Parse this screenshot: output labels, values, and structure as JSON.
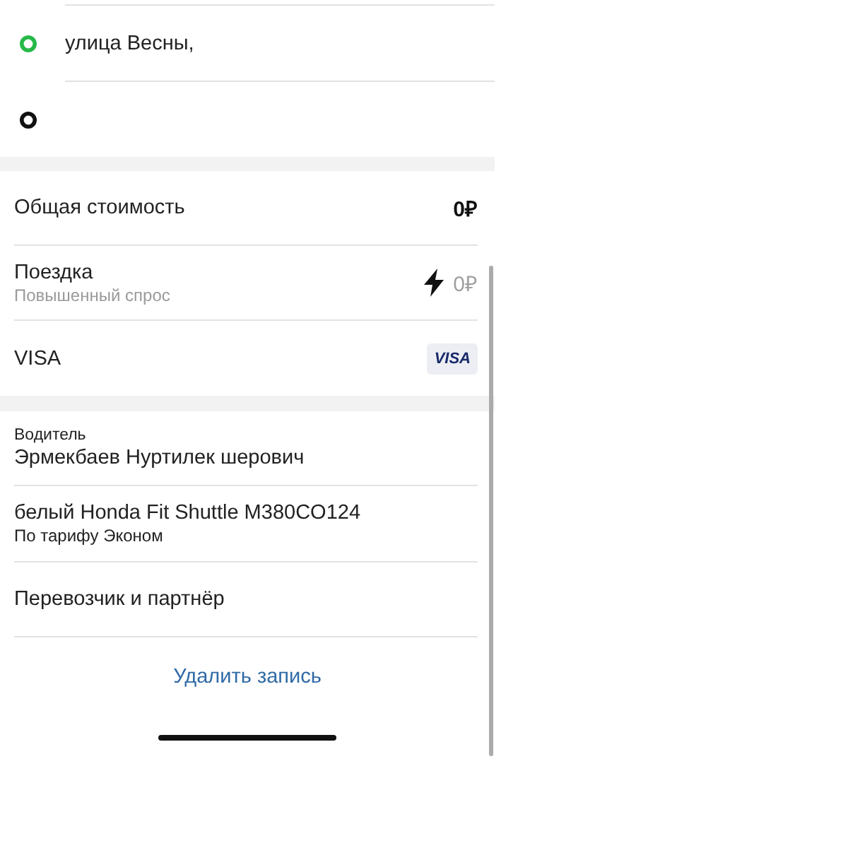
{
  "route": {
    "points": [
      {
        "address": "улица Весны,",
        "color": "#27b84a"
      },
      {
        "color": "#111111"
      }
    ]
  },
  "cost": {
    "rows": [
      {
        "kind": "total",
        "label": "Общая стоимость",
        "amount": "0₽"
      },
      {
        "kind": "surge",
        "label": "Поездка",
        "sublabel": "Повышенный спрос",
        "amount": "0₽"
      },
      {
        "kind": "payment",
        "label": "VISA",
        "badge": "VISA"
      }
    ]
  },
  "driver": {
    "rows": [
      {
        "kind": "person",
        "caption": "Водитель",
        "name": "Эрмекбаев Нуртилек шерович"
      },
      {
        "kind": "car",
        "title": "белый Honda Fit Shuttle M380CO124",
        "subtitle": "По тарифу Эконом"
      },
      {
        "kind": "link",
        "title": "Перевозчик и партнёр"
      }
    ]
  },
  "delete_button": "Удалить запись"
}
